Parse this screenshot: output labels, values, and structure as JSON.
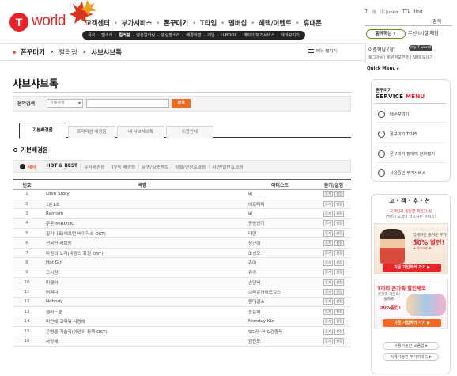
{
  "brand": {
    "logo_mark": "T",
    "logo_text": "world",
    "accent": "#e8242a",
    "orange": "#f06a23"
  },
  "gnb": [
    "고객센터",
    "부가서비스",
    "폰꾸미기",
    "T타임",
    "멤버십",
    "혜택/이벤트",
    "휴대폰"
  ],
  "gnb_active_index": 2,
  "subnav": [
    "뮤직",
    "벨소리",
    "컬러링",
    "영상컬러링",
    "영상벨소리",
    "배경화면",
    "게임",
    "U-BOOK",
    "캐릭터/부가서비스",
    "테마꾸미기"
  ],
  "subnav_active_index": 2,
  "top_right": {
    "sites": [
      "T",
      "ⓜ",
      "ⓣ Junior",
      "TTL",
      "ting"
    ],
    "search_label": "검색",
    "login_label": "함께하는 T",
    "login_link": "무선 Ⅰ시설Ⅰ체험"
  },
  "breadcrumb": {
    "level1": "폰꾸미기",
    "level2": "컬러링",
    "level3": "샤브샤브톡"
  },
  "menu_toggle_label": "메뉴 펼치기",
  "user": {
    "name": "이준혁님 (정)",
    "myworld": "my T world",
    "links": "로그아웃 | 회원정보변경 | SMS 보내기"
  },
  "page_title": "샤브샤브톡",
  "search": {
    "label": "음악검색",
    "select_value": "전체검색",
    "input_value": "",
    "button_label": "검색"
  },
  "tabs": [
    "기본배경음",
    "프리미엄 배경음",
    "내 샤브샤브톡",
    "이용안내"
  ],
  "tab_active_index": 0,
  "section_title": "기본배경음",
  "theme": {
    "label": "테마",
    "items": [
      "HOT & BEST",
      "뮤직배경음",
      "TV속 배경음",
      "유명/실용멘트",
      "상황/현장효과음",
      "자연/일반효과음"
    ],
    "active_index": 0
  },
  "table": {
    "headers": [
      "번호",
      "곡명",
      "아티스트",
      "듣기/설정"
    ],
    "listen_label": "듣기",
    "set_label": "설정",
    "rows": [
      {
        "no": "1",
        "title": "Love Story",
        "artist": "비"
      },
      {
        "no": "2",
        "title": "1분1초",
        "artist": "애프터미"
      },
      {
        "no": "3",
        "title": "Rainism",
        "artist": "비"
      },
      {
        "no": "4",
        "title": "주문-MIROTIC",
        "artist": "동방신기"
      },
      {
        "no": "5",
        "title": "필리나죠(애프턴 바이러스 OST)",
        "artist": "태연"
      },
      {
        "no": "6",
        "title": "전국민 러브송",
        "artist": "장근이"
      },
      {
        "no": "7",
        "title": "바람의 노래(바람의 화원 OST)",
        "artist": "조성모"
      },
      {
        "no": "8",
        "title": "Hot Girl",
        "artist": "쥬아"
      },
      {
        "no": "9",
        "title": "그시람",
        "artist": "쥬아"
      },
      {
        "no": "10",
        "title": "미쳤어",
        "artist": "손담비"
      },
      {
        "no": "11",
        "title": "어쩌다",
        "artist": "브라운아이드걸스"
      },
      {
        "no": "12",
        "title": "Nobody",
        "artist": "원더걸스"
      },
      {
        "no": "13",
        "title": "셀러드송",
        "artist": "윤은혜"
      },
      {
        "no": "14",
        "title": "미안해 고마워 사랑해",
        "artist": "Monday Kiz"
      },
      {
        "no": "15",
        "title": "운명을 거슬러(에덴의 동쪽 OST)",
        "artist": "SG워너비&김종욱"
      },
      {
        "no": "16",
        "title": "사랑해",
        "artist": "김건모"
      }
    ]
  },
  "sidebar": {
    "quick_menu_label": "Quick Menu ▸",
    "box_title1": "폰꾸미기",
    "box_title2a": "SERVICE",
    "box_title2b": "MENU",
    "items": [
      "내폰꾸미기",
      "폰꾸미기 TOP5",
      "폰꾸미기 장애에 전화접기",
      "사용중인 부가서비스"
    ],
    "rec_title": "고·객·추·천",
    "rec_sub1": "고객님과 동일한 회원님 및",
    "rec_sub2": "연령대 고객이 선호하는 서비스!",
    "banner1": {
      "desc": "함께하면 즐거운 부가서비스",
      "discount": "50% 할인!",
      "tag": "✦ bread ✦",
      "cta": "지금 가입하러 가기 ▶"
    },
    "banner2": {
      "headline": "T끼리 온가족 할인제도",
      "desc": "온가족 기본료/통화료",
      "discount": "50%할인!",
      "cta": "지금 가입하러 가기 ▶"
    },
    "pills": [
      "사용가능한 모음형 ▸",
      "사용가능한 부가서비스 ▸"
    ]
  }
}
